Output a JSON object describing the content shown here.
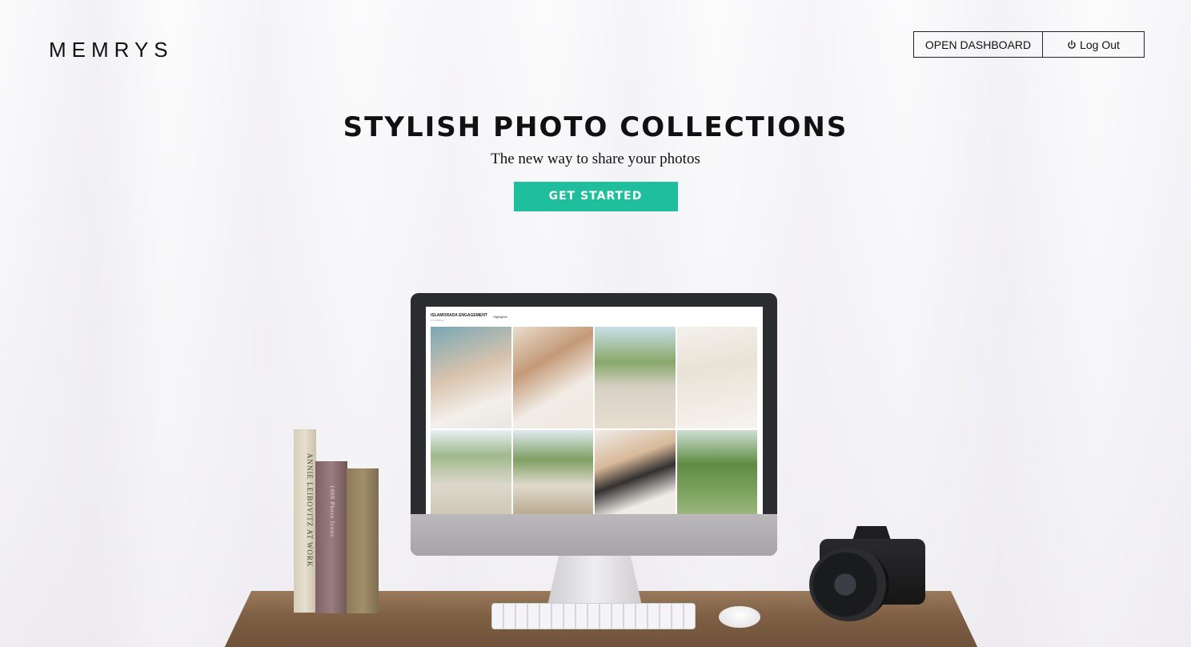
{
  "brand": {
    "logo": "MEMRYS"
  },
  "nav": {
    "dashboard_label": "OPEN DASHBOARD",
    "logout_label": "Log Out",
    "logout_icon": "power-icon"
  },
  "hero": {
    "title": "STYLISH PHOTO COLLECTIONS",
    "subtitle": "The new way to share your photos",
    "cta_label": "GET STARTED"
  },
  "screen": {
    "gallery_title": "ISLAMORADA ENGAGEMENT",
    "gallery_sub": "2.5 MARCH",
    "tab_label": "Highlights"
  },
  "books": {
    "book1": "ANNIE LEIBOVITZ AT WORK",
    "book2": "1000 Photo Icons"
  },
  "colors": {
    "accent": "#1fbf9d",
    "text": "#111111"
  }
}
